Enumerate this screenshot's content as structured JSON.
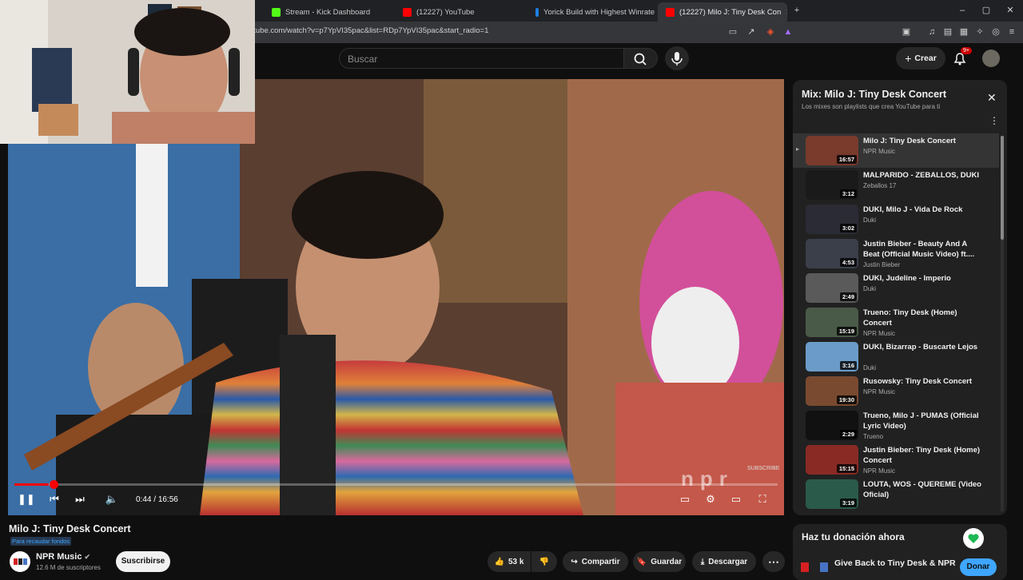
{
  "browser": {
    "tabs": [
      {
        "label": "Stream - Kick Dashboard",
        "favicon": "kick-icon",
        "color": "#53fc18"
      },
      {
        "label": "(12227) YouTube",
        "favicon": "youtube-icon",
        "color": "#ff0000"
      },
      {
        "label": "Yorick Build with Highest Winrate - L",
        "favicon": "lol-icon",
        "color": "#1f7fe0"
      },
      {
        "label": "(12227) Milo J: Tiny Desk Con",
        "favicon": "youtube-icon",
        "color": "#ff0000",
        "active": true
      }
    ],
    "url": "utube.com/watch?v=p7YpVI35pac&list=RDp7YpVI35pac&start_radio=1"
  },
  "header": {
    "search_placeholder": "Buscar",
    "create_label": "Crear",
    "notif_count": "9+"
  },
  "player": {
    "time_current": "0:44",
    "time_total": "16:56",
    "progress_fraction": 0.045,
    "overlay_subscribe": "SUBSCRIBE",
    "overlay_logo": "npr"
  },
  "video": {
    "title": "Milo J: Tiny Desk Concert",
    "fundraiser": "Para recaudar fondos",
    "channel": "NPR Music",
    "subscribers": "12.6 M de suscriptores",
    "subscribe_label": "Suscribirse",
    "likes": "53 k",
    "share_label": "Compartir",
    "save_label": "Guardar",
    "download_label": "Descargar"
  },
  "playlist": {
    "title": "Mix: Milo J: Tiny Desk Concert",
    "subtitle": "Los mixes son playlists que crea YouTube para ti",
    "items": [
      {
        "title": "Milo J: Tiny Desk Concert",
        "channel": "NPR Music",
        "duration": "16:57",
        "active": true,
        "thumb": "#7a3a2c"
      },
      {
        "title": "MALPARIDO - ZEBALLOS, DUKI",
        "channel": "Zeballos 17",
        "duration": "3:12",
        "thumb": "#1a1a1a"
      },
      {
        "title": "DUKI, Milo J - Vida De Rock",
        "channel": "Duki",
        "duration": "3:02",
        "thumb": "#2b2b35"
      },
      {
        "title": "Justin Bieber - Beauty And A Beat (Official Music Video) ft....",
        "channel": "Justin Bieber",
        "duration": "4:53",
        "thumb": "#3a3f4a"
      },
      {
        "title": "DUKI, Judeline - Imperio",
        "channel": "Duki",
        "duration": "2:49",
        "thumb": "#5a5a5a"
      },
      {
        "title": "Trueno: Tiny Desk (Home) Concert",
        "channel": "NPR Music",
        "duration": "15:19",
        "thumb": "#4a5a48"
      },
      {
        "title": "DUKI, Bizarrap - Buscarte Lejos",
        "channel": "Duki",
        "duration": "3:16",
        "thumb": "#6b9cc9"
      },
      {
        "title": "Rusowsky: Tiny Desk Concert",
        "channel": "NPR Music",
        "duration": "19:30",
        "thumb": "#7a4a30"
      },
      {
        "title": "Trueno, Milo J - PUMAS (Official Lyric Video)",
        "channel": "Trueno",
        "duration": "2:29",
        "thumb": "#111111"
      },
      {
        "title": "Justin Bieber: Tiny Desk (Home) Concert",
        "channel": "NPR Music",
        "duration": "15:15",
        "thumb": "#8a2a24"
      },
      {
        "title": "LOUTA, WOS - QUEREME (Video Oficial)",
        "channel": "",
        "duration": "3:19",
        "thumb": "#2a5a4a"
      }
    ]
  },
  "donation": {
    "title": "Haz tu donación ahora",
    "item": "Give Back to Tiny Desk & NPR",
    "button": "Donar"
  }
}
